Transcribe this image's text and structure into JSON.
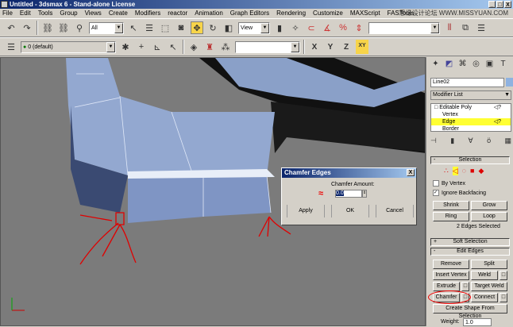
{
  "title": "Untitled - 3dsmax 6 - Stand-alone License",
  "window_buttons": [
    "_",
    "□",
    "X"
  ],
  "watermark": "思缘设计论坛 WWW.MISSYUAN.COM",
  "menu": [
    "File",
    "Edit",
    "Tools",
    "Group",
    "Views",
    "Create",
    "Modifiers",
    "reactor",
    "Animation",
    "Graph Editors",
    "Rendering",
    "Customize",
    "MAXScript",
    "FASTools"
  ],
  "toolbar1": {
    "selection_filter": "All",
    "ref_coord": "View"
  },
  "toolbar2": {
    "layer": "0 (default)",
    "named_sel": "",
    "axes": [
      "X",
      "Y",
      "Z",
      "XY"
    ]
  },
  "dialog": {
    "title": "Chamfer Edges",
    "label": "Chamfer Amount:",
    "value": "0.0",
    "apply": "Apply",
    "ok": "OK",
    "cancel": "Cancel",
    "close": "X"
  },
  "cmd": {
    "object_name": "Line02",
    "modifier_list": "Modifier List",
    "stack": [
      {
        "label": "Editable Poly"
      },
      {
        "label": "Vertex"
      },
      {
        "label": "Edge",
        "selected": true
      },
      {
        "label": "Border"
      }
    ],
    "selection": {
      "title": "Selection",
      "by_vertex": "By Vertex",
      "ignore_backfacing": "Ignore Backfacing",
      "shrink": "Shrink",
      "grow": "Grow",
      "ring": "Ring",
      "loop": "Loop",
      "status": "2 Edges Selected"
    },
    "soft_selection": "Soft Selection",
    "edit_edges": {
      "title": "Edit Edges",
      "remove": "Remove",
      "split": "Split",
      "insert_vertex": "Insert Vertex",
      "weld": "Weld",
      "extrude": "Extrude",
      "target_weld": "Target Weld",
      "chamfer": "Chamfer",
      "connect": "Connect",
      "create_shape": "Create Shape From Selection",
      "weight_label": "Weight:",
      "weight_value": "1.0"
    }
  },
  "colors": {
    "highlight": "#ffff33",
    "active_tool": "#f7d44a",
    "annotation": "#e00000"
  }
}
